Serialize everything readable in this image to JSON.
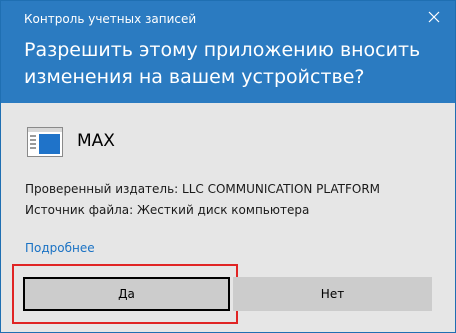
{
  "window": {
    "title": "Контроль учетных записей",
    "close_icon": "close-icon"
  },
  "prompt": {
    "question": "Разрешить этому приложению вносить изменения на вашем устройстве?"
  },
  "app": {
    "name": "MAX",
    "icon": "application-window-icon"
  },
  "details": {
    "publisher": "Проверенный издатель: LLC COMMUNICATION PLATFORM",
    "source": "Источник файла: Жесткий диск компьютера",
    "more_link": "Подробнее"
  },
  "buttons": {
    "yes": "Да",
    "no": "Нет"
  },
  "colors": {
    "header": "#2b7bc1",
    "body": "#e6e6e6",
    "link": "#1a72c4",
    "highlight": "#e02424"
  }
}
